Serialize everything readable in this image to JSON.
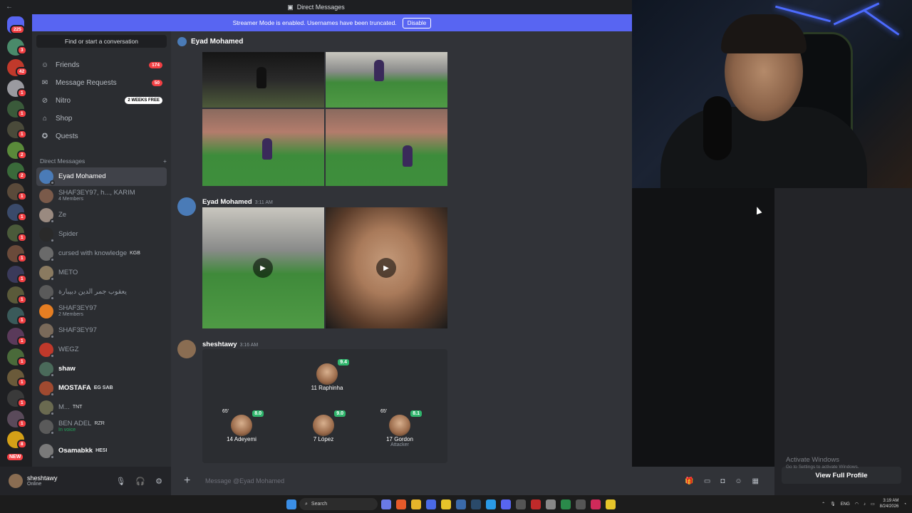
{
  "topbar": {
    "back": "←",
    "title": "Direct Messages",
    "icon": "inbox-icon"
  },
  "banner": {
    "text": "Streamer Mode is enabled. Usernames have been truncated.",
    "disable_label": "Disable"
  },
  "servers": {
    "home_badge": "225",
    "badges": [
      "3",
      "42",
      "1",
      "1",
      "1",
      "2",
      "2",
      "1",
      "1",
      "1",
      "1",
      "1",
      "1",
      "1",
      "1",
      "1",
      "1",
      "1",
      "1",
      "8"
    ],
    "new_label": "NEW"
  },
  "dmlist": {
    "search_placeholder": "Find or start a conversation",
    "nav": [
      {
        "label": "Friends",
        "icon": "friends-icon",
        "count": "174"
      },
      {
        "label": "Message Requests",
        "icon": "mail-icon",
        "count": "50"
      },
      {
        "label": "Nitro",
        "icon": "nitro-icon",
        "pill": "2 WEEKS FREE"
      },
      {
        "label": "Shop",
        "icon": "shop-icon"
      },
      {
        "label": "Quests",
        "icon": "quests-icon"
      }
    ],
    "header": "Direct Messages",
    "add": "+",
    "items": [
      {
        "name": "Eyad Mohamed",
        "color": "#4a7bb7"
      },
      {
        "name": "SHAF3EY97, h..., KARIM",
        "sub": "4 Members",
        "color": "#7a5a4a"
      },
      {
        "name": "Ze",
        "color": "#9a8a80"
      },
      {
        "name": "Spider",
        "color": "#2a2a2a"
      },
      {
        "name": "cursed with knowledge",
        "tag": "KGB",
        "color": "#6a6a6a"
      },
      {
        "name": "METO",
        "color": "#8a7a60"
      },
      {
        "name": "يعقوب جمر الدين دبيبارة",
        "color": "#5a5a5a"
      },
      {
        "name": "SHAF3EY97",
        "sub": "2 Members",
        "color": "#e67e22"
      },
      {
        "name": "SHAF3EY97",
        "color": "#7a6a5a"
      },
      {
        "name": "WEGZ",
        "color": "#c0392b"
      },
      {
        "name": "shaw",
        "color": "#4a6a5a",
        "bold": true
      },
      {
        "name": "MOSTAFA",
        "tag": "EG  SAB",
        "color": "#a04a30",
        "bold": true
      },
      {
        "name": "M...",
        "tag": "TNT",
        "color": "#6a6a50"
      },
      {
        "name": "BEN ADEL",
        "sub": "In voice",
        "tag": "RZR",
        "color": "#5a5a5a"
      },
      {
        "name": "Osamabkk",
        "tag": "HESI",
        "color": "#7a7a7a",
        "bold": true
      }
    ]
  },
  "user": {
    "name": "sheshtawy",
    "status": "Online"
  },
  "chat": {
    "header": "Eyad Mohamed",
    "messages": [
      {
        "author": "Eyad Mohamed",
        "time": "3:11 AM"
      },
      {
        "author": "sheshtawy",
        "time": "3:16 AM"
      }
    ],
    "lineup": [
      {
        "name": "11 Raphinha",
        "rating": "9.4"
      },
      {
        "name": "14 Adeyemi",
        "rating": "8.0",
        "minute": "65'"
      },
      {
        "name": "7 López",
        "rating": "9.0"
      },
      {
        "name": "17 Gordon",
        "rating": "8.1",
        "minute": "65'",
        "position": "Attacker"
      }
    ],
    "composer_placeholder": "Message @Eyad Mohamed"
  },
  "rightpane": {
    "view_profile": "View Full Profile"
  },
  "watermark": {
    "line1": "Activate Windows",
    "line2": "Go to Settings to activate Windows."
  },
  "taskbar": {
    "search": "Search",
    "time": "3:19 AM",
    "date": "8/24/2026",
    "lang": "ENG"
  }
}
